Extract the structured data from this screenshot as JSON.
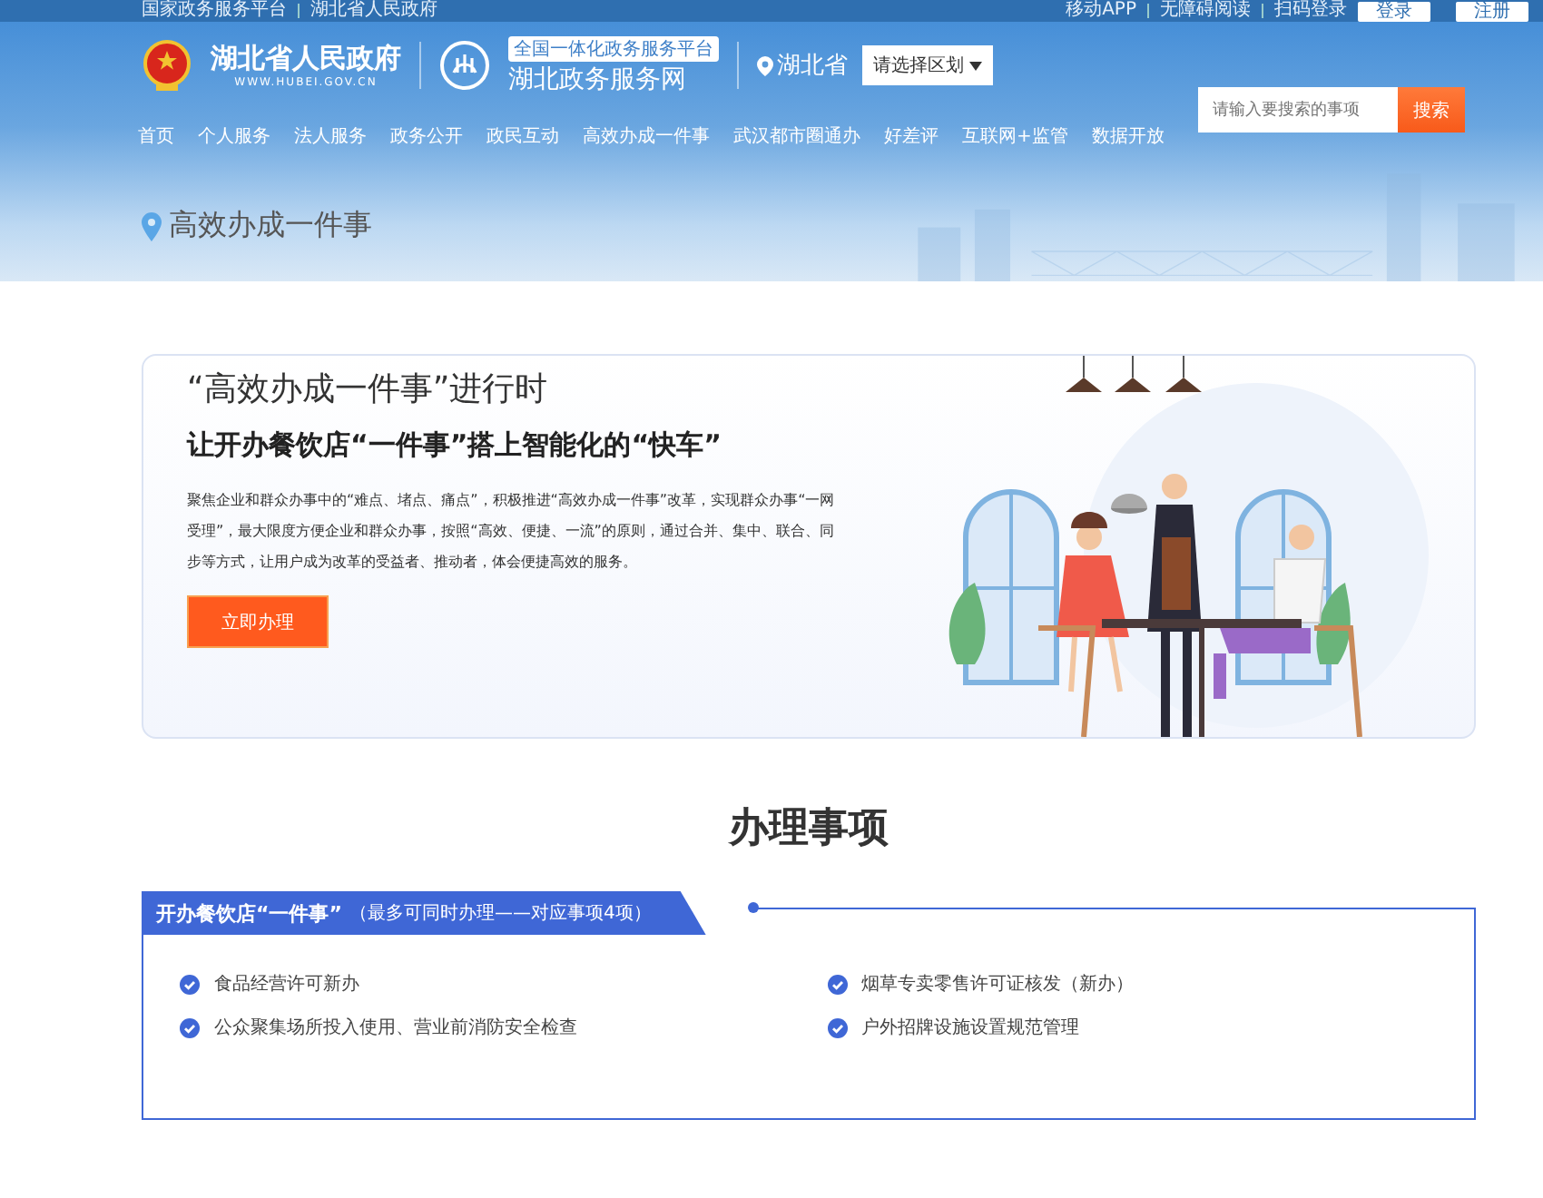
{
  "top_bar": {
    "left_links": [
      "国家政务服务平台",
      "湖北省人民政府"
    ],
    "right_links": [
      "移动APP",
      "无障碍阅读",
      "扫码登录"
    ],
    "buttons": [
      "登录",
      "注册"
    ]
  },
  "header": {
    "gov_name": "湖北省人民政府",
    "gov_url": "WWW.HUBEI.GOV.CN",
    "platform_tag": "全国一体化政务服务平台",
    "platform_name": "湖北政务服务网",
    "location": "湖北省",
    "region_select": "请选择区划"
  },
  "nav": [
    "首页",
    "个人服务",
    "法人服务",
    "政务公开",
    "政民互动",
    "高效办成一件事",
    "武汉都市圈通办",
    "好差评",
    "互联网+监管",
    "数据开放"
  ],
  "search": {
    "placeholder": "请输入要搜索的事项",
    "button": "搜索"
  },
  "breadcrumb": "高效办成一件事",
  "hero": {
    "title": "“高效办成一件事”进行时",
    "subtitle": "让开办餐饮店“一件事”搭上智能化的“快车”",
    "description": "聚焦企业和群众办事中的“难点、堵点、痛点”，积极推进“高效办成一件事”改革，实现群众办事“一网受理”，最大限度方便企业和群众办事，按照“高效、便捷、一流”的原则，通过合并、集中、联合、同步等方式，让用户成为改革的受益者、推动者，体会便捷高效的服务。",
    "button": "立即办理"
  },
  "section_title": "办理事项",
  "panel": {
    "tab_title": "开办餐饮店“一件事”",
    "tab_note": "（最多可同时办理——对应事项4项）",
    "items": [
      {
        "label": "食品经营许可新办",
        "checked": true
      },
      {
        "label": "烟草专卖零售许可证核发（新办）",
        "checked": true
      },
      {
        "label": "公众聚集场所投入使用、营业前消防安全检查",
        "checked": true
      },
      {
        "label": "户外招牌设施设置规范管理",
        "checked": true
      }
    ]
  }
}
